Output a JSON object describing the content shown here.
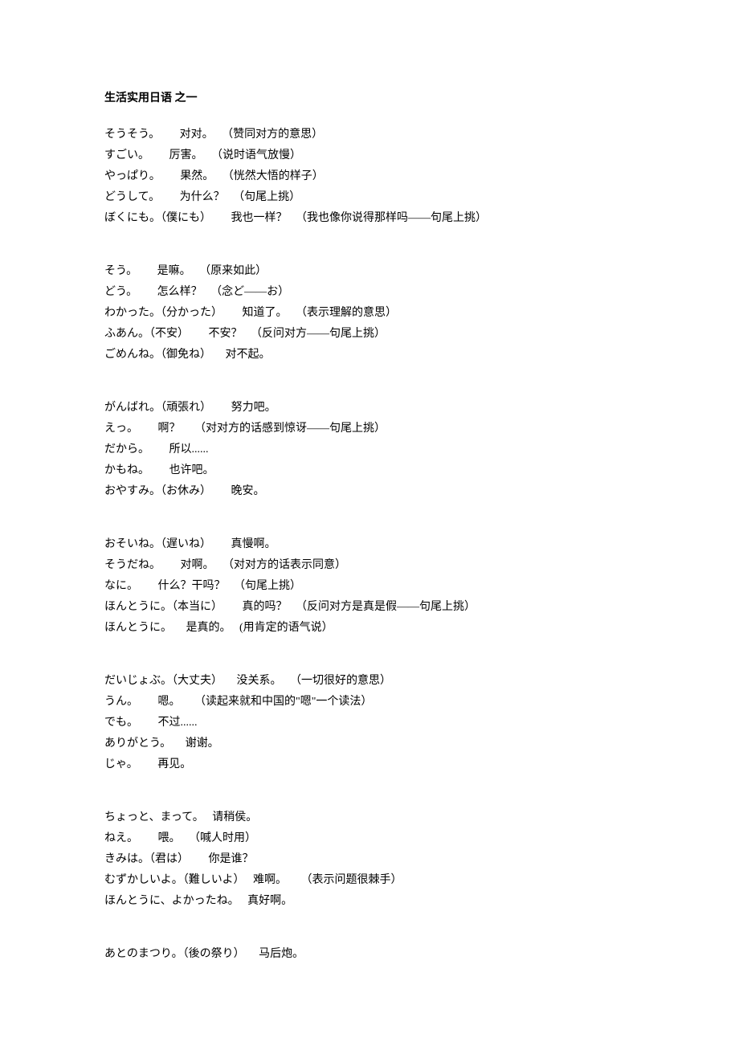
{
  "title": "生活实用日语   之一",
  "groups": [
    [
      "そうそう。       对对。   （赞同对方的意思）",
      "すごい。       厉害。   （说时语气放慢）",
      "やっぱり。       果然。   （恍然大悟的样子）",
      "どうして。       为什么？   （句尾上挑）",
      "ぼくにも。（僕にも）       我也一样？   （我也像你说得那样吗——句尾上挑）"
    ],
    [
      "そう。       是嘛。   （原来如此）",
      "どう。       怎么样？   （念ど——お）",
      "わかった。（分かった）       知道了。   （表示理解的意思）",
      "ふあん。（不安）       不安？   （反问对方——句尾上挑）",
      "ごめんね。（御免ね）     对不起。"
    ],
    [
      "がんばれ。（頑張れ）       努力吧。",
      "えっ。       啊？     （对对方的话感到惊讶——句尾上挑）",
      "だから。       所以......",
      "かもね。       也许吧。",
      "おやすみ。（お休み）       晚安。"
    ],
    [
      "おそいね。（遅いね）       真慢啊。",
      "そうだね。       对啊。   （对对方的话表示同意）",
      "なに。       什么？干吗？   （句尾上挑）",
      "ほんとうに。（本当に）       真的吗？   （反问对方是真是假——句尾上挑）",
      "ほんとうに。     是真的。   (用肯定的语气说）"
    ],
    [
      "だいじょぶ。（大丈夫）     没关系。   （一切很好的意思）",
      "うん。       嗯。     （读起来就和中国的\"嗯\"一个读法）",
      "でも。       不过......",
      "ありがとう。     谢谢。",
      "じゃ。       再见。"
    ],
    [
      "ちょっと、まって。   请稍侯。",
      "ねえ。       喂。   （喊人时用）",
      "きみは。（君は）       你是谁？",
      "むずかしいよ。（難しいよ）   难啊。     （表示问题很棘手）",
      "ほんとうに、よかったね。   真好啊。"
    ],
    [
      "あとのまつり。（後の祭り）     马后炮。"
    ]
  ]
}
